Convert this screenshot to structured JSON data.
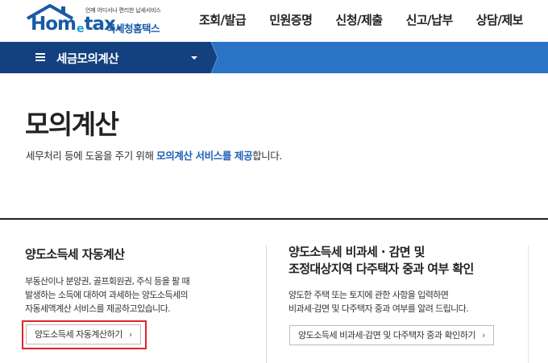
{
  "header": {
    "logo": {
      "tagline": "언제 어디서나 편리한 납세서비스",
      "brand_home": "Hom",
      "brand_e": "e",
      "brand_tax": "tax.",
      "sub": "국세청홈택스"
    },
    "nav": [
      "조회/발급",
      "민원증명",
      "신청/제출",
      "신고/납부",
      "상담/제보"
    ]
  },
  "menubar": {
    "label": "세금모의계산",
    "colors": {
      "dark": "#13407e",
      "light": "#2a73c5"
    }
  },
  "page": {
    "title": "모의계산",
    "desc_before": "세무처리 등에 도움을 주기 위해 ",
    "desc_highlight": "모의계산 서비스를 제공",
    "desc_after": "합니다."
  },
  "cards": [
    {
      "title_lines": [
        "양도소득세 자동계산"
      ],
      "text_lines": [
        "부동산이나 분양권, 골프회원권, 주식 등을 팔 때",
        "발생하는 소득에 대하여 과세하는 양도소득세의",
        "자동세액계산 서비스를 제공하고있습니다."
      ],
      "button_label": "양도소득세 자동계산하기"
    },
    {
      "title_lines": [
        "양도소득세 비과세 · 감면 및",
        "조정대상지역 다주택자 중과 여부 확인"
      ],
      "text_lines": [
        "양도한 주택 또는 토지에 관한 사항을 입력하면",
        "비과세·감면 및 다주택자 중과 여부를 알려 드립니다."
      ],
      "button_label": "양도소득세 비과세·감면 및 다주택자 중과 확인하기"
    }
  ],
  "accent_colors": {
    "highlight_border": "#e0232a",
    "link_blue": "#1e5fb8"
  }
}
